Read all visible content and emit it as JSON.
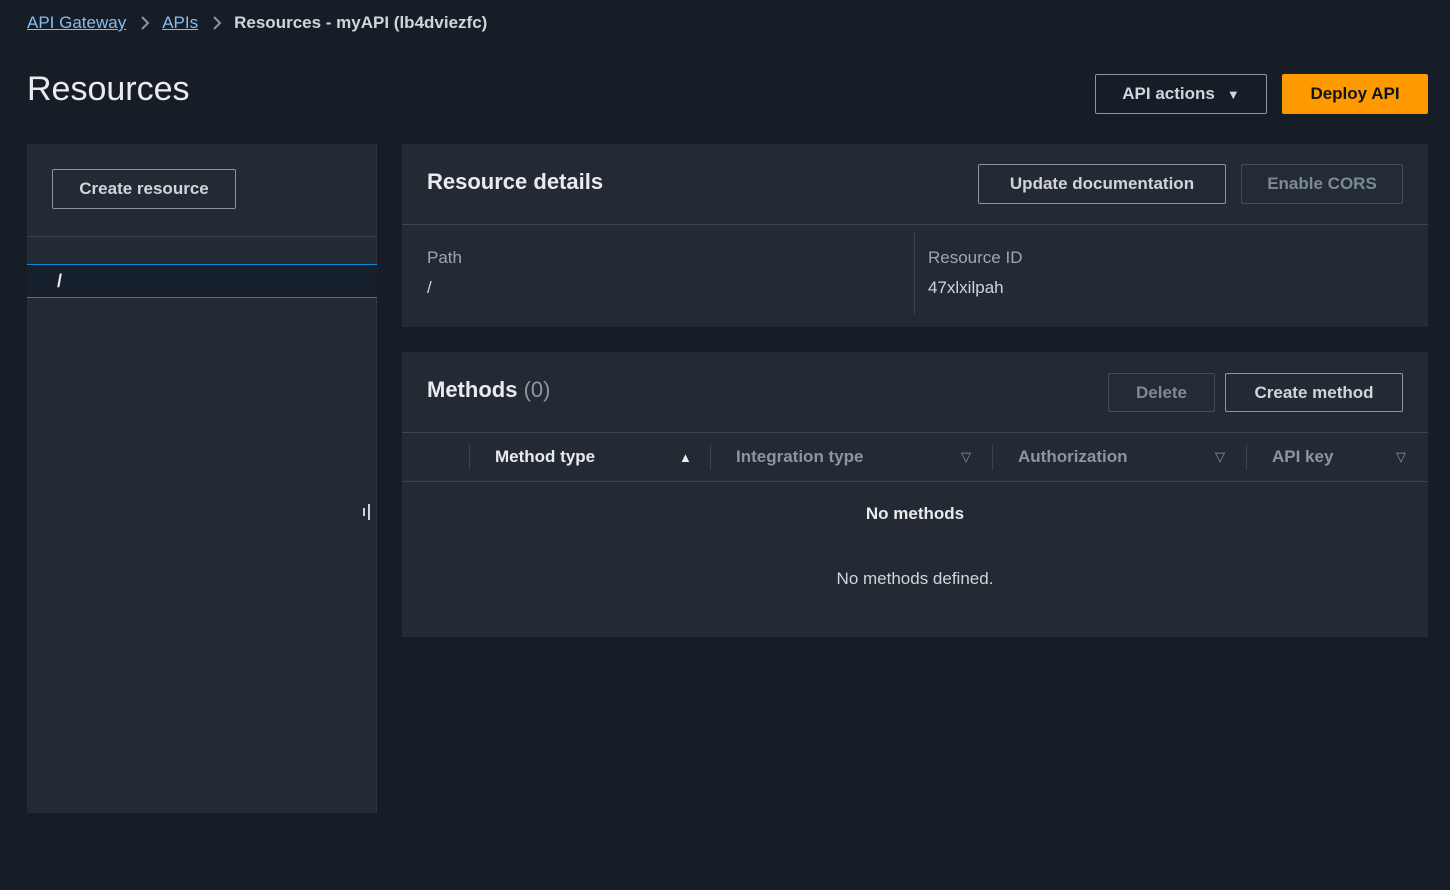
{
  "breadcrumb": {
    "items": [
      "API Gateway",
      "APIs"
    ],
    "current": "Resources - myAPI (lb4dviezfc)"
  },
  "page": {
    "title": "Resources",
    "api_actions_label": "API actions",
    "deploy_label": "Deploy API"
  },
  "sidebar": {
    "create_resource_label": "Create resource",
    "tree": [
      {
        "path": "/",
        "selected": true
      }
    ]
  },
  "resource_details": {
    "title": "Resource details",
    "update_doc_label": "Update documentation",
    "enable_cors_label": "Enable CORS",
    "path_label": "Path",
    "path_value": "/",
    "resource_id_label": "Resource ID",
    "resource_id_value": "47xlxilpah"
  },
  "methods": {
    "title": "Methods",
    "count": "(0)",
    "delete_label": "Delete",
    "create_label": "Create method",
    "columns": [
      "Method type",
      "Integration type",
      "Authorization",
      "API key"
    ],
    "empty_title": "No methods",
    "empty_desc": "No methods defined."
  },
  "colors": {
    "background": "#161d26",
    "panel": "#232a33",
    "accent": "#ff9900",
    "link": "#89bdee",
    "selection_border": "#0d8ad4"
  }
}
